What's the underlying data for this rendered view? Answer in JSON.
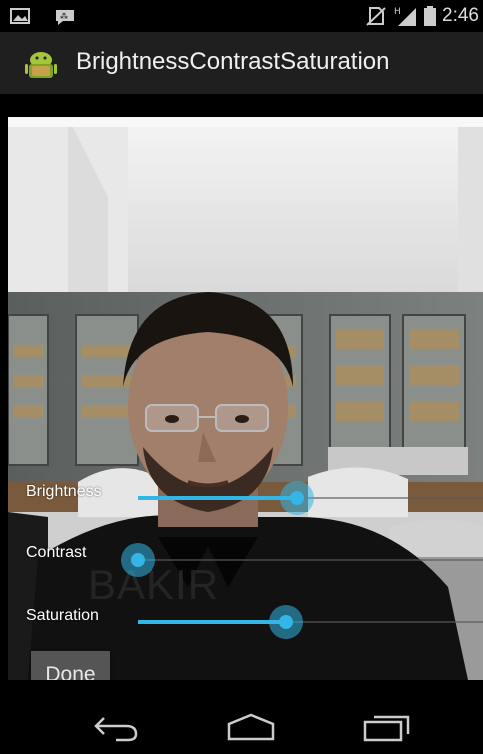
{
  "status_bar": {
    "time": "2:46",
    "icons": [
      "image-notification-icon",
      "messenger-notification-icon",
      "no-sim-icon",
      "signal-icon",
      "battery-icon"
    ]
  },
  "action_bar": {
    "app_icon": "android-app-icon",
    "title": "BrightnessContrastSaturation"
  },
  "camera_preview": {
    "overlay_text": "BAKIR"
  },
  "controls": {
    "sliders": [
      {
        "label": "Brightness",
        "value": 0.46
      },
      {
        "label": "Contrast",
        "value": 0.0
      },
      {
        "label": "Saturation",
        "value": 0.43
      }
    ],
    "done_label": "Done"
  },
  "nav_bar": {
    "icons": [
      "back-icon",
      "home-icon",
      "recent-apps-icon"
    ]
  },
  "colors": {
    "accent": "#33b5e5",
    "action_bar": "#1f1f1f",
    "button": "#555555"
  }
}
